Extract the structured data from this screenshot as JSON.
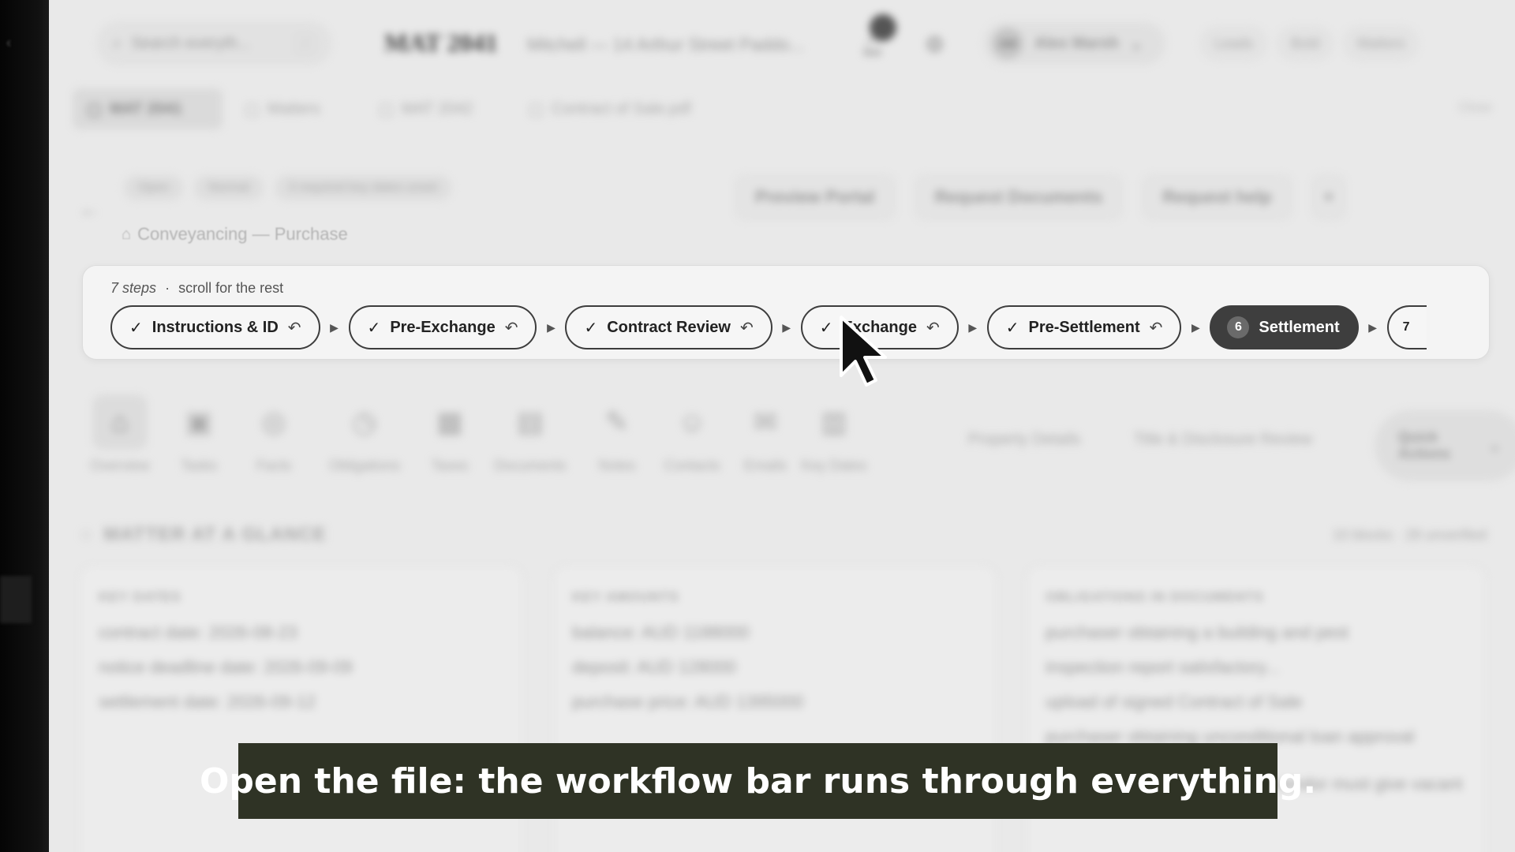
{
  "topbar": {
    "search_placeholder": "Search everyth...",
    "search_shortcut": "/",
    "matter_id": "MAT 2041",
    "matter_name": "Mitchell — 14 Arthur Street Paddo...",
    "user_initials": "AM",
    "user_name": "Alex Marsh",
    "actions": [
      "Leads",
      "Bold",
      "Matters"
    ]
  },
  "tabs": {
    "items": [
      {
        "label": "MAT 2041",
        "active": true
      },
      {
        "label": "Matters",
        "active": false
      },
      {
        "label": "MAT 2042",
        "active": false
      },
      {
        "label": "Contract of Sale.pdf",
        "active": false
      }
    ],
    "right": "Close"
  },
  "header": {
    "chips": [
      "Open",
      "Normal",
      "3 required key dates unset"
    ],
    "actions": [
      "Preview Portal",
      "Request Documents",
      "Request help"
    ],
    "more": "+",
    "breadcrumb": "Conveyancing — Purchase"
  },
  "workflow": {
    "meta_count": "7 steps",
    "meta_sep": "·",
    "meta_hint": "scroll for the rest",
    "steps": [
      {
        "label": "Instructions & ID",
        "done": true
      },
      {
        "label": "Pre-Exchange",
        "done": true
      },
      {
        "label": "Contract Review",
        "done": true
      },
      {
        "label": "Exchange",
        "done": true
      },
      {
        "label": "Pre-Settlement",
        "done": true
      },
      {
        "label": "Settlement",
        "number": "6",
        "current": true
      },
      {
        "label": "7",
        "partial": true
      }
    ]
  },
  "nav": {
    "items": [
      "Overview",
      "Tasks",
      "Facts",
      "Obligations",
      "Taxes",
      "Documents",
      "Notes",
      "Contacts",
      "Emails",
      "Key Dates"
    ],
    "text_items": [
      "Property Details",
      "Title & Disclosure Review"
    ],
    "quick": "Quick Actions"
  },
  "glance": {
    "title": "MATTER AT A GLANCE",
    "right": "10 blocks · 28 unverified",
    "cards": [
      {
        "title": "KEY DATES",
        "lines": [
          "contract date: 2026-08-23",
          "notice deadline date: 2026-09-09",
          "settlement date: 2026-09-12"
        ]
      },
      {
        "title": "KEY AMOUNTS",
        "lines": [
          "balance: AUD 1188000",
          "deposit: AUD 128000",
          "purchase price: AUD 1395000"
        ]
      },
      {
        "title": "OBLIGATIONS IN DOCUMENTS",
        "lines": [
          "purchaser obtaining a building and pest",
          "inspection report satisfactory...",
          "upload of signed Contract of Sale",
          "purchaser obtaining unconditional loan approval",
          "vendor must give vacant"
        ]
      }
    ]
  },
  "caption": "Open the file: the workflow bar runs through everything."
}
